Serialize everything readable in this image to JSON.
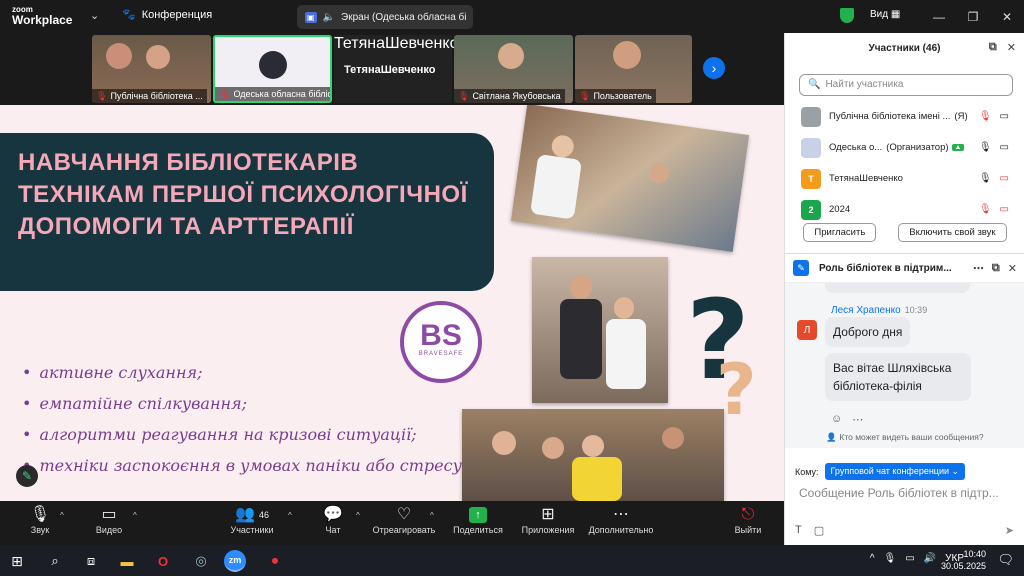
{
  "titlebar": {
    "logo_line1": "zoom",
    "logo_line2": "Workplace",
    "meeting_label": "Конференция",
    "share_indicator": "Экран (Одеська обласна бі",
    "view_label": "Вид"
  },
  "participants_strip": [
    {
      "name": "Публічна бібліотека ..."
    },
    {
      "name": "Одеська обласна бібліо..."
    },
    {
      "name": "ТетянаШевченко",
      "big_name": "ТетянаШевченко"
    },
    {
      "name": "Світлана Якубовська"
    },
    {
      "name": "Пользователь"
    }
  ],
  "slide": {
    "title": "НАВЧАННЯ БІБЛІОТЕКАРІВ ТЕХНІКАМ ПЕРШОЇ ПСИХОЛОГІЧНОЇ ДОПОМОГИ ТА АРТТЕРАПІЇ",
    "logo_main": "BS",
    "logo_sub": "BRAVESAFE",
    "bullets": [
      "активне слухання;",
      "емпатійне спілкування;",
      "алгоритми реагування на кризові ситуації;",
      "техніки заспокоєння в умовах паніки або стресу."
    ]
  },
  "toolbar": {
    "audio": "Звук",
    "video": "Видео",
    "participants": "Участники",
    "participants_count": "46",
    "chat": "Чат",
    "react": "Отреагировать",
    "share": "Поделиться",
    "apps": "Приложения",
    "more": "Дополнительно",
    "leave": "Выйти"
  },
  "panel": {
    "title": "Участники (46)",
    "search_placeholder": "Найти участника",
    "rows": [
      {
        "name": "Публічна бібліотека імені ...",
        "tag": "(Я)",
        "avatar_text": "",
        "avatar_color": "#9aa0a6"
      },
      {
        "name": "Одеська о...",
        "tag": "(Организатор)",
        "avatar_text": "",
        "avatar_color": "#c7d2e6"
      },
      {
        "name": "ТетянаШевченко",
        "tag": "",
        "avatar_text": "Т",
        "avatar_color": "#f29b1d"
      },
      {
        "name": "2024",
        "tag": "",
        "avatar_text": "2",
        "avatar_color": "#1aa64a"
      }
    ],
    "invite_button": "Пригласить",
    "unmute_button": "Включить свой звук"
  },
  "chat": {
    "title": "Роль бібліотек в підтрим...",
    "sender": "Леся Храпенко",
    "time": "10:39",
    "avatar_letter": "Л",
    "messages": [
      "Доброго дня",
      "Вас вітає Шляхівська бібліотека-філія"
    ],
    "visibility_note": "Кто может видеть ваши сообщения?",
    "to_label": "Кому:",
    "to_value": "Групповой чат конференции",
    "input_placeholder": "Сообщение Роль бібліотек в підтр..."
  },
  "taskbar": {
    "lang": "УКР",
    "time": "10:40",
    "date": "30.05.2025",
    "zoom_app_label": "zm"
  },
  "colors": {
    "zoom_blue": "#0e72ed",
    "banner": "#17353e",
    "title_pink": "#f7a8b8",
    "bullet_purple": "#7a3d8f",
    "green": "#22b14c"
  }
}
